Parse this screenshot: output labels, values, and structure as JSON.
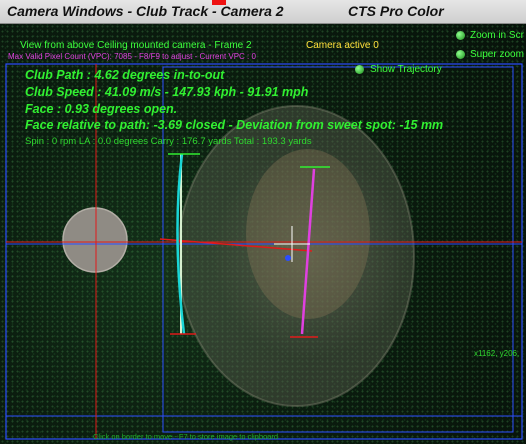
{
  "window": {
    "title": "Camera Windows - Club Track - Camera 2",
    "right_title": "CTS Pro Color"
  },
  "overlay": {
    "view_info": "View from above Ceiling mounted camera - Frame 2",
    "camera_active": "Camera active 0",
    "max_valid": "Max Valid Pixel Count (VPC): 7085 - F8/F9 to adjust - Current VPC : 0",
    "zoom_option_1": "Zoom in Scr",
    "zoom_option_2": "Super zoom",
    "show_trajectory": "Show Trajectory",
    "club_path": "Club Path : 4.62 degrees in-to-out",
    "club_speed": "Club Speed : 41.09 m/s - 147.93 kph - 91.91 mph",
    "face": "Face : 0.93 degrees open.",
    "face_relative": "Face relative to path: -3.69 closed - Deviation from sweet spot: -15 mm",
    "spin_line": "Spin : 0 rpm  LA : 0.0 degrees  Carry : 176.7 yards  Total : 193.3 yards",
    "coords": "x1162, y206,",
    "bottom_hint": "Click on border to move - F7 to store image to clipboard"
  },
  "colors": {
    "text_green": "#31f031",
    "yellow": "#ffe23c",
    "magenta": "#e040e0",
    "grid_blue": "#2b4dff",
    "marker_red": "#e11a1a"
  }
}
